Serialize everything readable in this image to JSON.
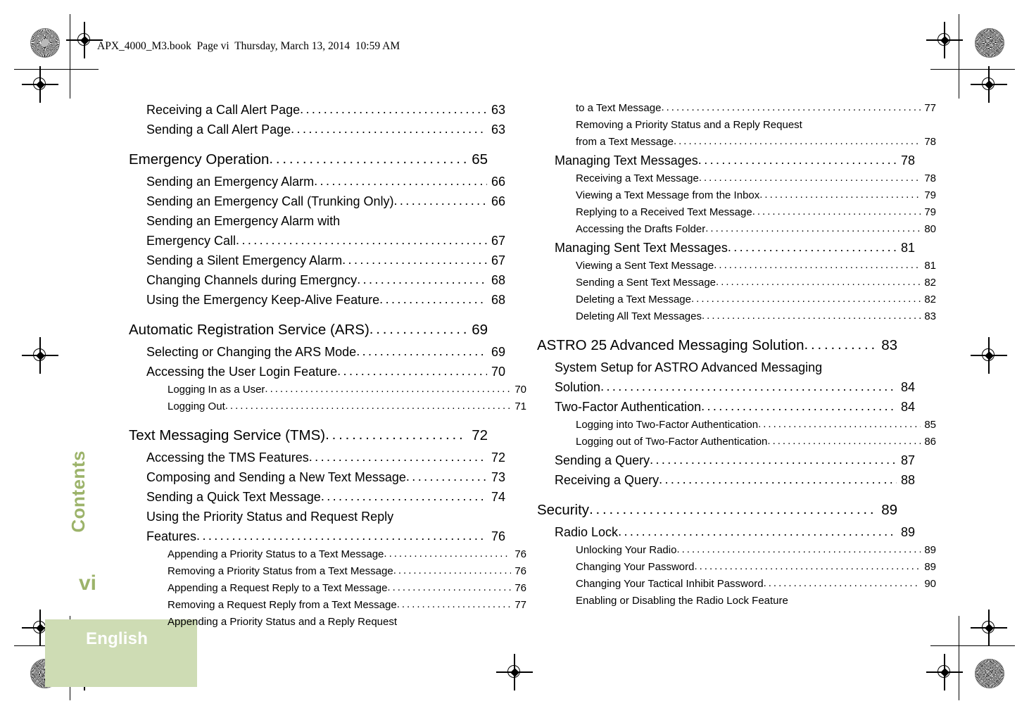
{
  "document": {
    "header_line": "APX_4000_M3.book  Page vi  Thursday, March 13, 2014  10:59 AM",
    "sidebar_tab_label": "Contents",
    "folio": "vi",
    "language_tab": "English",
    "accent_green": "#9cb36a",
    "tab_green": "#cedcb4"
  },
  "toc": {
    "left_column": [
      {
        "level": 2,
        "text": "Receiving a Call Alert Page",
        "page": "63",
        "spaced": false,
        "leader": true
      },
      {
        "level": 2,
        "text": "Sending a Call Alert Page",
        "page": "63",
        "spaced": false,
        "leader": true
      },
      {
        "level": 1,
        "text": "Emergency Operation",
        "page": "65",
        "spaced": true,
        "leader": true
      },
      {
        "level": 2,
        "text": "Sending an Emergency Alarm",
        "page": "66",
        "spaced": false,
        "leader": true
      },
      {
        "level": 2,
        "text": "Sending an Emergency Call (Trunking Only)",
        "page": "66",
        "spaced": false,
        "leader": true
      },
      {
        "level": 2,
        "text": "Sending an Emergency Alarm with",
        "page": "",
        "spaced": false,
        "leader": false
      },
      {
        "level": 2,
        "text": "Emergency Call",
        "page": "67",
        "spaced": false,
        "leader": true
      },
      {
        "level": 2,
        "text": "Sending a Silent Emergency Alarm",
        "page": "67",
        "spaced": false,
        "leader": true
      },
      {
        "level": 2,
        "text": "Changing Channels during Emergncy",
        "page": "68",
        "spaced": false,
        "leader": true
      },
      {
        "level": 2,
        "text": "Using the Emergency Keep-Alive Feature",
        "page": "68",
        "spaced": false,
        "leader": true
      },
      {
        "level": 1,
        "text": "Automatic Registration Service (ARS)",
        "page": "69",
        "spaced": true,
        "leader": true
      },
      {
        "level": 2,
        "text": "Selecting or Changing the ARS Mode",
        "page": "69",
        "spaced": false,
        "leader": true
      },
      {
        "level": 2,
        "text": "Accessing the User Login Feature",
        "page": "70",
        "spaced": false,
        "leader": true
      },
      {
        "level": 3,
        "text": "Logging In as a User",
        "page": "70",
        "spaced": false,
        "leader": true
      },
      {
        "level": 3,
        "text": "Logging Out",
        "page": "71",
        "spaced": false,
        "leader": true
      },
      {
        "level": 1,
        "text": "Text Messaging Service (TMS)",
        "page": "72",
        "spaced": true,
        "leader": true
      },
      {
        "level": 2,
        "text": "Accessing the TMS Features",
        "page": "72",
        "spaced": false,
        "leader": true
      },
      {
        "level": 2,
        "text": "Composing and Sending a New Text Message",
        "page": "73",
        "spaced": false,
        "leader": true
      },
      {
        "level": 2,
        "text": "Sending a Quick Text Message",
        "page": "74",
        "spaced": false,
        "leader": true
      },
      {
        "level": 2,
        "text": "Using the Priority Status and Request Reply",
        "page": "",
        "spaced": false,
        "leader": false
      },
      {
        "level": 2,
        "text": "Features",
        "page": "76",
        "spaced": false,
        "leader": true
      },
      {
        "level": 3,
        "text": "Appending a Priority Status to a Text Message",
        "page": "76",
        "spaced": false,
        "leader": true
      },
      {
        "level": 3,
        "text": "Removing a Priority Status from a Text Message",
        "page": "76",
        "spaced": false,
        "leader": true
      },
      {
        "level": 3,
        "text": "Appending a Request Reply to a Text Message",
        "page": "76",
        "spaced": false,
        "leader": true
      },
      {
        "level": 3,
        "text": "Removing a Request Reply from a Text Message",
        "page": "77",
        "spaced": false,
        "leader": true
      },
      {
        "level": 3,
        "text": "Appending a Priority Status and a Reply Request",
        "page": "",
        "spaced": false,
        "leader": false
      }
    ],
    "right_column": [
      {
        "level": 3,
        "text": "to a Text Message",
        "page": "77",
        "spaced": false,
        "leader": true
      },
      {
        "level": 3,
        "text": "Removing a Priority Status and a Reply Request",
        "page": "",
        "spaced": false,
        "leader": false
      },
      {
        "level": 3,
        "text": "from a Text Message",
        "page": "78",
        "spaced": false,
        "leader": true
      },
      {
        "level": 2,
        "text": "Managing Text Messages",
        "page": "78",
        "spaced": false,
        "leader": true
      },
      {
        "level": 3,
        "text": "Receiving a Text Message",
        "page": "78",
        "spaced": false,
        "leader": true
      },
      {
        "level": 3,
        "text": "Viewing a Text Message from the Inbox",
        "page": "79",
        "spaced": false,
        "leader": true
      },
      {
        "level": 3,
        "text": "Replying to a Received Text Message",
        "page": "79",
        "spaced": false,
        "leader": true
      },
      {
        "level": 3,
        "text": "Accessing the Drafts Folder",
        "page": "80",
        "spaced": false,
        "leader": true
      },
      {
        "level": 2,
        "text": "Managing Sent Text Messages",
        "page": "81",
        "spaced": false,
        "leader": true
      },
      {
        "level": 3,
        "text": "Viewing a Sent Text Message",
        "page": "81",
        "spaced": false,
        "leader": true
      },
      {
        "level": 3,
        "text": "Sending a Sent Text Message",
        "page": "82",
        "spaced": false,
        "leader": true
      },
      {
        "level": 3,
        "text": "Deleting a Text Message",
        "page": "82",
        "spaced": false,
        "leader": true
      },
      {
        "level": 3,
        "text": "Deleting All Text Messages",
        "page": "83",
        "spaced": false,
        "leader": true
      },
      {
        "level": 1,
        "text": "ASTRO 25 Advanced Messaging Solution",
        "page": "83",
        "spaced": true,
        "leader": true
      },
      {
        "level": 2,
        "text": "System Setup for ASTRO Advanced Messaging",
        "page": "",
        "spaced": false,
        "leader": false
      },
      {
        "level": 2,
        "text": "Solution",
        "page": "84",
        "spaced": false,
        "leader": true
      },
      {
        "level": 2,
        "text": "Two-Factor Authentication",
        "page": "84",
        "spaced": false,
        "leader": true
      },
      {
        "level": 3,
        "text": "Logging into Two-Factor Authentication",
        "page": "85",
        "spaced": false,
        "leader": true
      },
      {
        "level": 3,
        "text": "Logging out of Two-Factor Authentication",
        "page": "86",
        "spaced": false,
        "leader": true
      },
      {
        "level": 2,
        "text": "Sending a Query",
        "page": "87",
        "spaced": false,
        "leader": true
      },
      {
        "level": 2,
        "text": "Receiving a Query",
        "page": "88",
        "spaced": false,
        "leader": true
      },
      {
        "level": 1,
        "text": "Security",
        "page": "89",
        "spaced": true,
        "leader": true
      },
      {
        "level": 2,
        "text": "Radio Lock",
        "page": "89",
        "spaced": false,
        "leader": true
      },
      {
        "level": 3,
        "text": "Unlocking Your Radio",
        "page": "89",
        "spaced": false,
        "leader": true
      },
      {
        "level": 3,
        "text": "Changing Your Password",
        "page": "89",
        "spaced": false,
        "leader": true
      },
      {
        "level": 3,
        "text": "Changing Your Tactical Inhibit Password",
        "page": "90",
        "spaced": false,
        "leader": true
      },
      {
        "level": 3,
        "text": "Enabling or Disabling the Radio Lock Feature",
        "page": "",
        "spaced": false,
        "leader": false
      }
    ]
  }
}
